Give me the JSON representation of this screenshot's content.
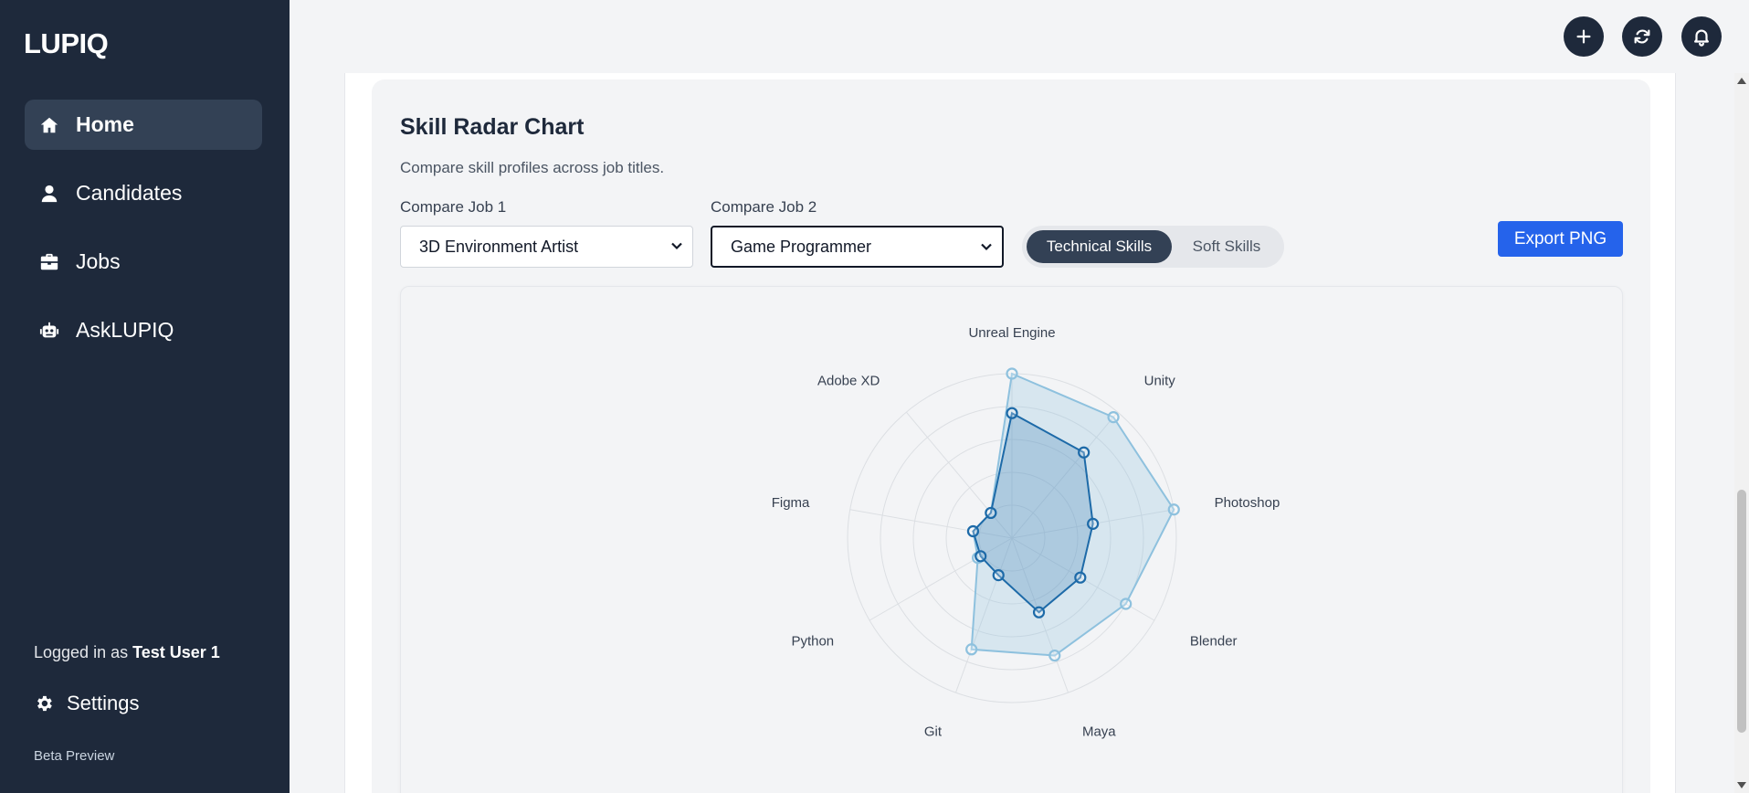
{
  "app": {
    "logo": "LUPIQ"
  },
  "sidebar": {
    "items": [
      {
        "label": "Home",
        "icon": "home-icon",
        "active": true
      },
      {
        "label": "Candidates",
        "icon": "user-icon"
      },
      {
        "label": "Jobs",
        "icon": "briefcase-icon"
      },
      {
        "label": "AskLUPIQ",
        "icon": "robot-icon"
      }
    ],
    "logged_prefix": "Logged in as",
    "user_name": "Test User 1",
    "settings_label": "Settings",
    "beta_label": "Beta Preview"
  },
  "topbar": {
    "buttons": [
      "plus-icon",
      "refresh-icon",
      "bell-icon"
    ]
  },
  "card": {
    "title": "Skill Radar Chart",
    "subtitle": "Compare skill profiles across job titles.",
    "job1_label": "Compare Job 1",
    "job1_value": "3D Environment Artist",
    "job2_label": "Compare Job 2",
    "job2_value": "Game Programmer",
    "toggle_technical": "Technical Skills",
    "toggle_soft": "Soft Skills",
    "export_label": "Export PNG"
  },
  "colors": {
    "sidebar_bg": "#1e293b",
    "accent": "#2563eb",
    "series1": "#8ec1de",
    "series2": "#1d6aa8"
  },
  "chart_data": {
    "type": "radar",
    "axes": [
      "Unreal Engine",
      "Unity",
      "Photoshop",
      "Blender",
      "Maya",
      "Git",
      "Python",
      "Figma",
      "Adobe XD"
    ],
    "max": 5,
    "rings": 5,
    "series": [
      {
        "values": [
          5,
          4.8,
          5,
          4,
          3.8,
          3.6,
          1.2,
          1.2,
          1.0
        ]
      },
      {
        "values": [
          3.8,
          3.4,
          2.5,
          2.4,
          2.4,
          1.2,
          1.1,
          1.2,
          1.0
        ]
      }
    ]
  }
}
